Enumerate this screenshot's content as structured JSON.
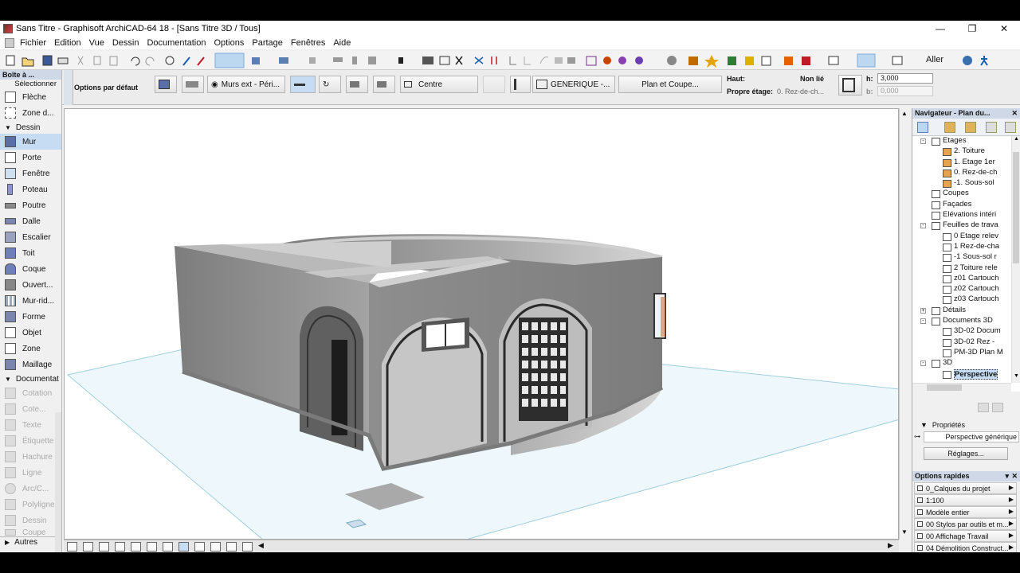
{
  "window": {
    "title": "Sans Titre - Graphisoft ArchiCAD-64 18 - [Sans Titre 3D / Tous]",
    "controls": [
      "—",
      "❐",
      "✕"
    ]
  },
  "menu": [
    "Fichier",
    "Edition",
    "Vue",
    "Dessin",
    "Documentation",
    "Options",
    "Partage",
    "Fenêtres",
    "Aide"
  ],
  "toolbar": {
    "aller_label": "Aller"
  },
  "infobox": {
    "options": "Options par défaut",
    "wall_type": "Murs ext - Péri...",
    "ref_line": "Centre",
    "profile": "GENERIQUE -...",
    "plan_section": "Plan et Coupe...",
    "haut_label": "Haut:",
    "haut_value": "Non lié",
    "etage_label": "Propre étage:",
    "etage_value": "0. Rez-de-ch...",
    "h_label": "h:",
    "h_value": "3,000",
    "b_label": "b:",
    "b_value": "0,000"
  },
  "toolbox": {
    "title": "Boîte à ...",
    "select_label": "Sélectionner",
    "select_items": [
      "Flèche",
      "Zone d..."
    ],
    "groups": [
      {
        "name": "Dessin",
        "items": [
          "Mur",
          "Porte",
          "Fenêtre",
          "Poteau",
          "Poutre",
          "Dalle",
          "Escalier",
          "Toit",
          "Coque",
          "Ouvert...",
          "Mur-rid...",
          "Forme",
          "Objet",
          "Zone",
          "Maillage"
        ]
      },
      {
        "name": "Documentat",
        "items": [
          "Cotation",
          "Cote...",
          "Texte",
          "Étiquette",
          "Hachure",
          "Ligne",
          "Arc/C...",
          "Polyligne",
          "Dessin",
          "Coupe"
        ]
      }
    ],
    "active_item": "Mur",
    "more_label": "Autres"
  },
  "navigator": {
    "title": "Navigateur - Plan du...",
    "tree": [
      {
        "label": "Etages",
        "level": 0,
        "expander": "-"
      },
      {
        "label": "2. Toiture",
        "level": 1
      },
      {
        "label": "1. Etage 1er",
        "level": 1
      },
      {
        "label": "0. Rez-de-ch",
        "level": 1
      },
      {
        "label": "-1. Sous-sol",
        "level": 1
      },
      {
        "label": "Coupes",
        "level": 0
      },
      {
        "label": "Façades",
        "level": 0
      },
      {
        "label": "Elévations intéri",
        "level": 0
      },
      {
        "label": "Feuilles de trava",
        "level": 0,
        "expander": "-"
      },
      {
        "label": "0 Etage relev",
        "level": 1
      },
      {
        "label": "1 Rez-de-cha",
        "level": 1
      },
      {
        "label": "-1 Sous-sol r",
        "level": 1
      },
      {
        "label": "2 Toiture rele",
        "level": 1
      },
      {
        "label": "z01 Cartouch",
        "level": 1
      },
      {
        "label": "z02 Cartouch",
        "level": 1
      },
      {
        "label": "z03 Cartouch",
        "level": 1
      },
      {
        "label": "Détails",
        "level": 0,
        "expander": "+"
      },
      {
        "label": "Documents 3D",
        "level": 0,
        "expander": "-"
      },
      {
        "label": "3D-02 Docum",
        "level": 1
      },
      {
        "label": "3D-02 Rez -",
        "level": 1
      },
      {
        "label": "PM-3D Plan M",
        "level": 1
      },
      {
        "label": "3D",
        "level": 0,
        "expander": "-"
      },
      {
        "label": "Perspective",
        "level": 1,
        "selected": true
      }
    ]
  },
  "properties": {
    "title": "Propriétés",
    "view_name": "Perspective générique",
    "settings_button": "Réglages..."
  },
  "quick_options": {
    "title": "Options rapides",
    "rows": [
      "0_Calques du projet",
      "1:100",
      "Modèle entier",
      "00 Stylos par outils et m...",
      "00 Affichage Travail",
      "04 Démolition Construct..."
    ]
  },
  "colors": {
    "panel_header": "#cfd8e6",
    "selection": "#c6dcf2",
    "ground_plane": "#eef8fc",
    "wall_gray": "#8a8a8a"
  }
}
